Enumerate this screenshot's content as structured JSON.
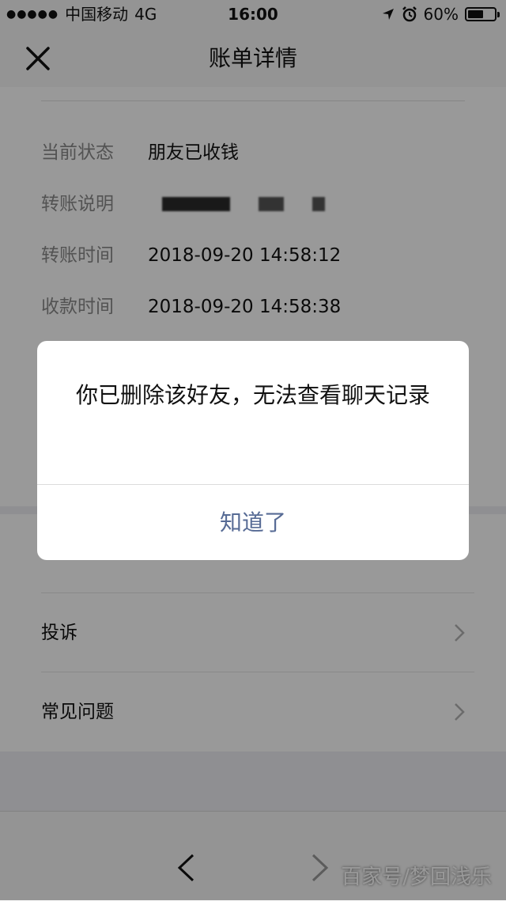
{
  "status_bar": {
    "signal_dots": "●●●●●",
    "carrier": "中国移动",
    "network": "4G",
    "time": "16:00",
    "battery_text": "60%",
    "battery_level": 0.6,
    "icons": [
      "location-arrow-icon",
      "alarm-icon",
      "battery-icon"
    ]
  },
  "navbar": {
    "title": "账单详情",
    "close_icon": "close-icon"
  },
  "details": {
    "rows": [
      {
        "label": "当前状态",
        "value": "朋友已收钱"
      },
      {
        "label": "转账说明",
        "value": ""
      },
      {
        "label": "转账时间",
        "value": "2018-09-20 14:58:12"
      },
      {
        "label": "收款时间",
        "value": "2018-09-20 14:58:38"
      }
    ]
  },
  "list": {
    "items": [
      {
        "label": "投诉"
      },
      {
        "label": "常见问题"
      }
    ]
  },
  "dialog": {
    "message": "你已删除该好友，无法查看聊天记录",
    "button": "知道了"
  },
  "toolbar": {
    "back_icon": "chevron-left-icon",
    "forward_icon": "chevron-right-icon"
  },
  "watermark": "百家号/梦回浅乐",
  "colors": {
    "link": "#576b95",
    "label_gray": "#8a8a8a",
    "background": "#efeff4"
  }
}
